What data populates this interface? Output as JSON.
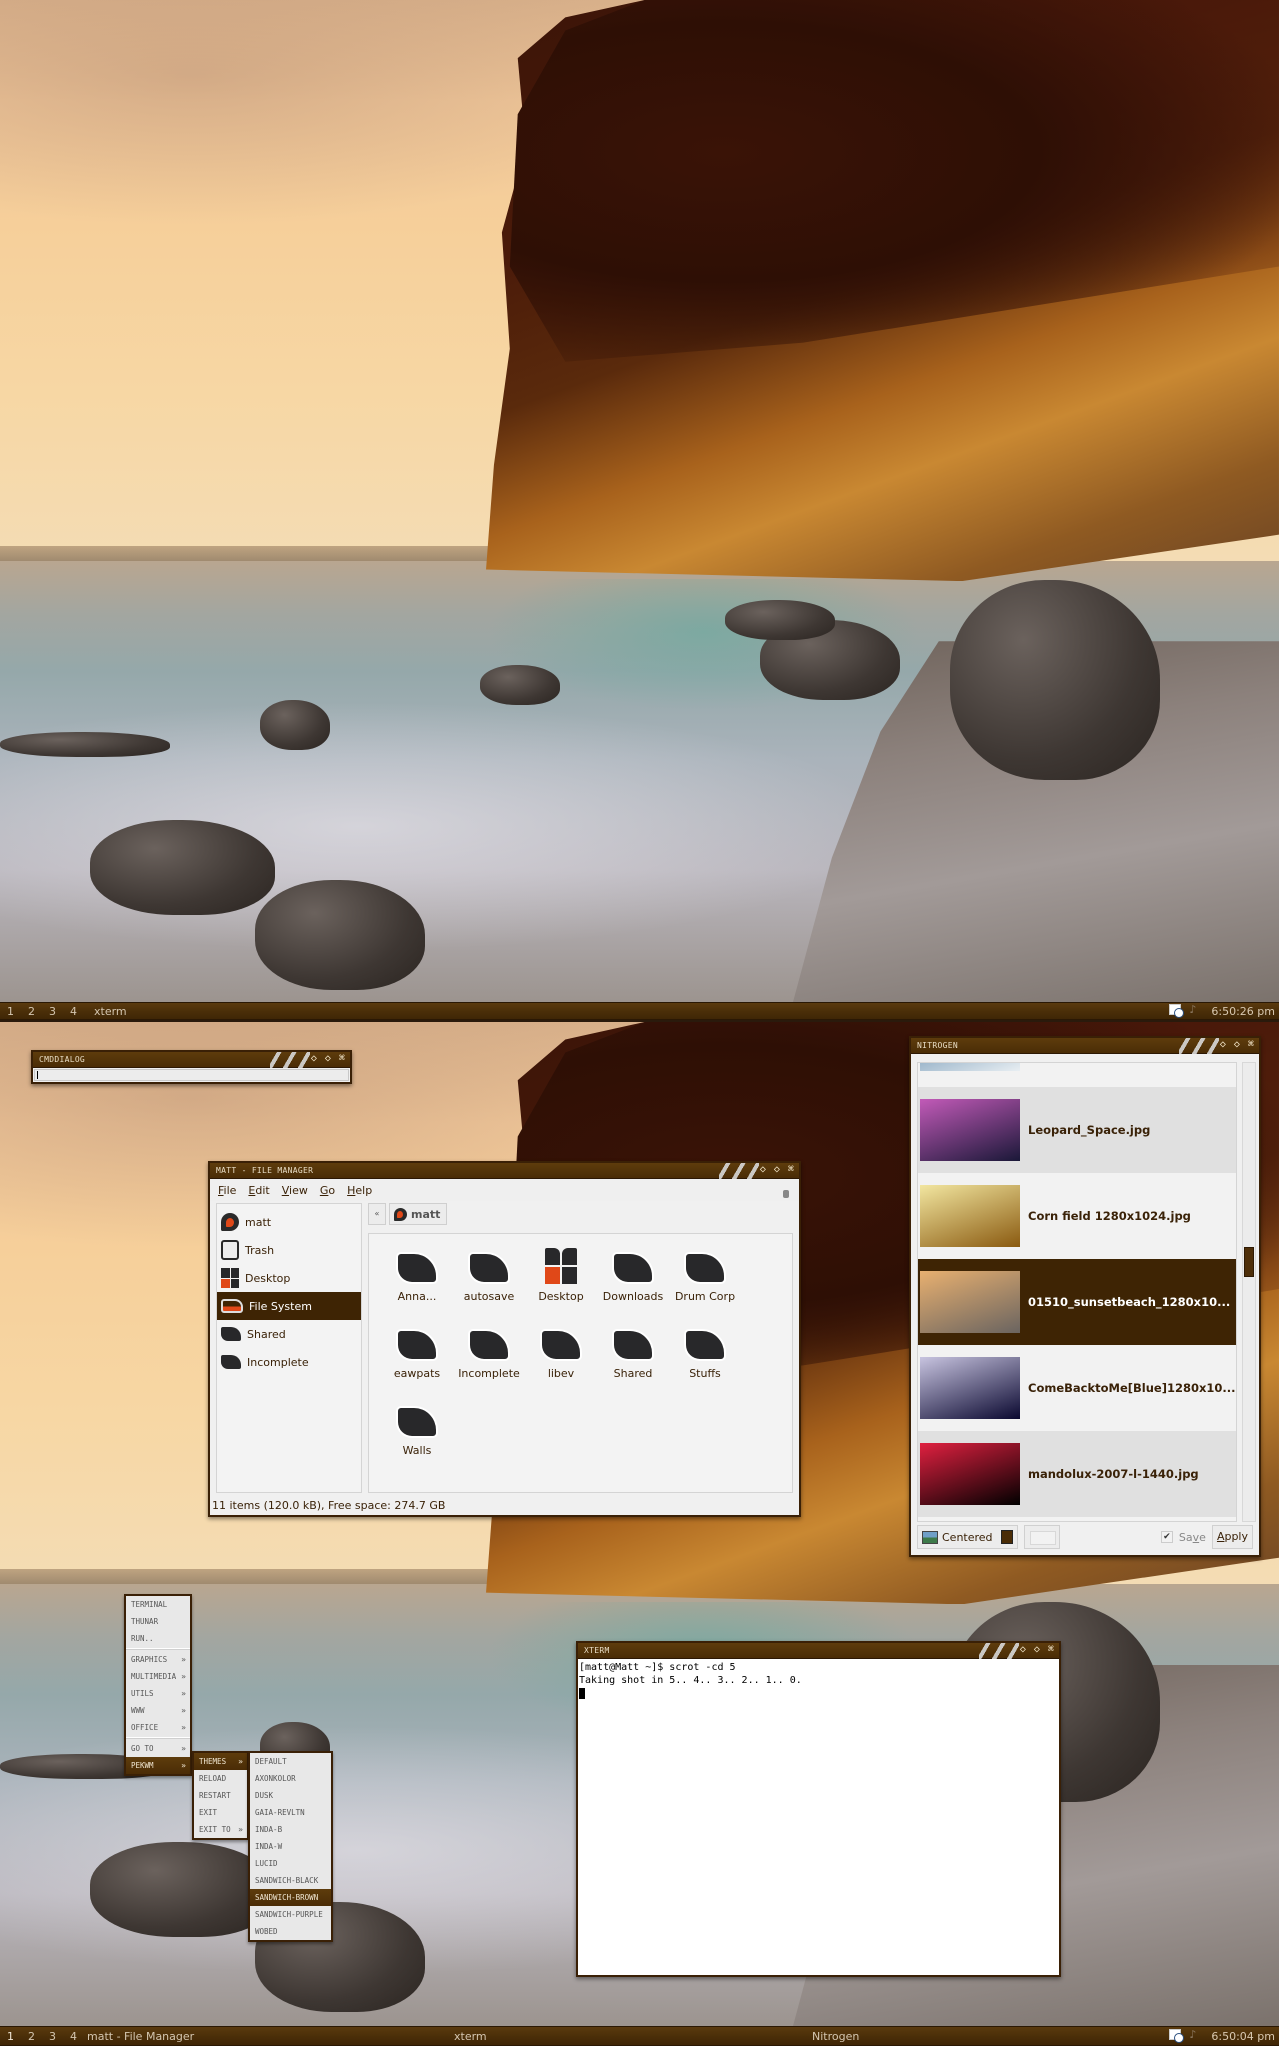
{
  "screens": [
    {
      "panel": {
        "workspaces": [
          "1",
          "2",
          "3",
          "4"
        ],
        "tasks": [
          "xterm"
        ],
        "clock": "6:50:26 pm"
      }
    },
    {
      "panel": {
        "workspaces": [
          "1",
          "2",
          "3",
          "4"
        ],
        "tasks": [
          "matt - File Manager",
          "xterm",
          "Nitrogen"
        ],
        "clock": "6:50:04 pm"
      },
      "cmddialog": {
        "title": "CMDDIALOG",
        "value": ""
      },
      "file_manager": {
        "title": "MATT - FILE MANAGER",
        "menu": [
          {
            "accel": "F",
            "rest": "ile"
          },
          {
            "accel": "E",
            "rest": "dit"
          },
          {
            "accel": "V",
            "rest": "iew"
          },
          {
            "accel": "G",
            "rest": "o"
          },
          {
            "accel": "H",
            "rest": "elp"
          }
        ],
        "sidebar": [
          {
            "label": "matt",
            "icon": "home-icon",
            "selected": false
          },
          {
            "label": "Trash",
            "icon": "trash-icon",
            "selected": false
          },
          {
            "label": "Desktop",
            "icon": "desktop-icon",
            "selected": false
          },
          {
            "label": "File System",
            "icon": "drive-icon",
            "selected": true
          },
          {
            "label": "Shared",
            "icon": "folder-icon",
            "selected": false
          },
          {
            "label": "Incomplete",
            "icon": "folder-icon",
            "selected": false
          }
        ],
        "path": {
          "back_label": "«",
          "current": "matt"
        },
        "items": [
          {
            "label": "Anna...",
            "icon": "folder-icon"
          },
          {
            "label": "autosave",
            "icon": "folder-icon"
          },
          {
            "label": "Desktop",
            "icon": "desktop-icon"
          },
          {
            "label": "Downloads",
            "icon": "folder-icon"
          },
          {
            "label": "Drum Corp",
            "icon": "folder-icon"
          },
          {
            "label": "eawpats",
            "icon": "folder-icon"
          },
          {
            "label": "Incomplete",
            "icon": "folder-icon"
          },
          {
            "label": "libev",
            "icon": "folder-icon"
          },
          {
            "label": "Shared",
            "icon": "folder-icon"
          },
          {
            "label": "Stuffs",
            "icon": "folder-icon"
          },
          {
            "label": "Walls",
            "icon": "folder-icon"
          }
        ],
        "status": "11 items (120.0 kB), Free space: 274.7 GB"
      },
      "nitrogen": {
        "title": "NITROGEN",
        "wallpapers": [
          {
            "name": "",
            "thumb_colors": [
              "#9fb8cc",
              "#e8eef2"
            ],
            "selected": false,
            "partial": "top"
          },
          {
            "name": "Leopard_Space.jpg",
            "thumb_colors": [
              "#c25ab8",
              "#1a1838"
            ],
            "selected": false
          },
          {
            "name": "Corn field 1280x1024.jpg",
            "thumb_colors": [
              "#f2e6a0",
              "#8a5a10"
            ],
            "selected": false
          },
          {
            "name": "01510_sunsetbeach_1280x10...",
            "thumb_colors": [
              "#e8b070",
              "#6a6460"
            ],
            "selected": true
          },
          {
            "name": "ComeBacktoMe[Blue]1280x10...",
            "thumb_colors": [
              "#c8c4e0",
              "#0a0830"
            ],
            "selected": false
          },
          {
            "name": "mandolux-2007-l-1440.jpg",
            "thumb_colors": [
              "#e02040",
              "#000000"
            ],
            "selected": false
          },
          {
            "name": "",
            "thumb_colors": [
              "#2a8a3a",
              "#7ac88a"
            ],
            "selected": false,
            "partial": "bottom"
          }
        ],
        "mode": "Centered",
        "bg_color": "#4a2c06",
        "save_label": "Save",
        "save_accel": "v",
        "save_checked": true,
        "apply_label": "Apply",
        "apply_accel": "A"
      },
      "root_menu": {
        "items": [
          {
            "label": "TERMINAL",
            "submenu": false
          },
          {
            "label": "THUNAR",
            "submenu": false
          },
          {
            "label": "RUN..",
            "submenu": false
          },
          {
            "separator": true
          },
          {
            "label": "GRAPHICS",
            "submenu": true
          },
          {
            "label": "MULTIMEDIA",
            "submenu": true
          },
          {
            "label": "UTILS",
            "submenu": true
          },
          {
            "label": "WWW",
            "submenu": true
          },
          {
            "label": "OFFICE",
            "submenu": true
          },
          {
            "separator": true
          },
          {
            "label": "GO TO",
            "submenu": true
          },
          {
            "label": "PEKWM",
            "submenu": true,
            "selected": true
          }
        ],
        "pekwm_submenu": [
          {
            "label": "THEMES",
            "submenu": true,
            "selected": true
          },
          {
            "label": "RELOAD",
            "submenu": false
          },
          {
            "label": "RESTART",
            "submenu": false
          },
          {
            "label": "EXIT",
            "submenu": false
          },
          {
            "label": "EXIT TO",
            "submenu": true
          }
        ],
        "themes_submenu": [
          {
            "label": "DEFAULT"
          },
          {
            "label": "AXONKOLOR"
          },
          {
            "label": "DUSK"
          },
          {
            "label": "GAIA-REVLTN"
          },
          {
            "label": "INDA-B"
          },
          {
            "label": "INDA-W"
          },
          {
            "label": "LUCID"
          },
          {
            "label": "SANDWICH-BLACK"
          },
          {
            "label": "SANDWICH-BROWN",
            "selected": true
          },
          {
            "label": "SANDWICH-PURPLE"
          },
          {
            "label": "WOBED"
          }
        ],
        "submenu_arrow": "»"
      },
      "xterm": {
        "title": "XTERM",
        "lines": [
          "[matt@Matt ~]$ scrot -cd 5",
          "Taking shot in 5.. 4.. 3.. 2.. 1.. 0."
        ]
      }
    }
  ],
  "window_buttons": {
    "iconify": "◇",
    "maximize": "◇",
    "close": "⌘"
  },
  "colors": {
    "accent": "#3e2404",
    "titlebar": "#4a2c06",
    "highlight_orange": "#e04818"
  }
}
